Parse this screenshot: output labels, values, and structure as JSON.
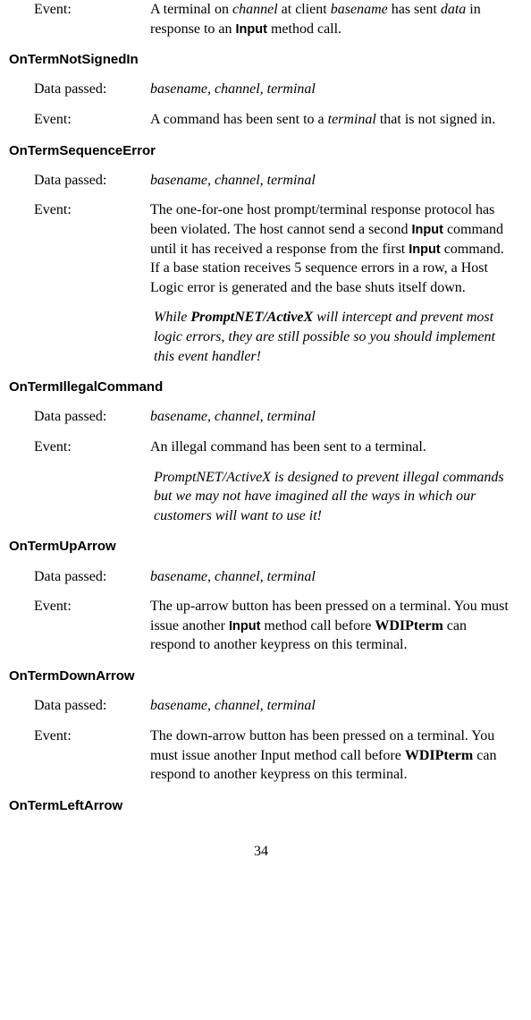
{
  "s0": {
    "event_label": "Event:",
    "event_desc": "A terminal on <em>channel</em> at client <em>basename</em> has sent <em>data</em> in response to an <span class=\"bold-sans\">Input</span> method call."
  },
  "s1": {
    "heading": "OnTermNotSignedIn",
    "data_label": "Data passed:",
    "data_desc": "<em>basename, channel, terminal</em>",
    "event_label": "Event:",
    "event_desc": "A command has been sent to a <em>terminal</em> that is not signed in."
  },
  "s2": {
    "heading": "OnTermSequenceError",
    "data_label": "Data passed:",
    "data_desc": "<em>basename, channel, terminal</em>",
    "event_label": "Event:",
    "event_desc": "The one-for-one host prompt/terminal response protocol has been violated. The host cannot send a second <span class=\"bold-sans\">Input</span> command until it has received a response from the first <span class=\"bold-sans\">Input</span> command. If a base station receives 5 sequence errors in a row, a Host Logic error is generated and the base shuts itself down.",
    "note": "<em>While <span class=\"bold-italic\">PromptNET/ActiveX</span> will intercept and prevent most logic errors, they are still possible so you should implement this event handler!</em>"
  },
  "s3": {
    "heading": "OnTermIllegalCommand",
    "data_label": "Data passed:",
    "data_desc": "<em>basename, channel, terminal</em>",
    "event_label": "Event:",
    "event_desc": "An illegal command has been sent to a terminal.",
    "note": "<em>PromptNET/ActiveX is designed to prevent illegal commands but  we may not have imagined all the ways in which our customers will want to use it!</em>"
  },
  "s4": {
    "heading": "OnTermUpArrow",
    "data_label": "Data passed:",
    "data_desc": "<em>basename, channel, terminal</em>",
    "event_label": "Event:",
    "event_desc": "The up-arrow button has been pressed on a terminal. You must issue another <span class=\"bold-sans\">Input</span> method call before <span class=\"bold-serif\">WDIPterm</span> can respond to another keypress on this terminal."
  },
  "s5": {
    "heading": "OnTermDownArrow",
    "data_label": "Data passed:",
    "data_desc": "<em>basename, channel, terminal</em>",
    "event_label": "Event:",
    "event_desc": "The down-arrow button has been pressed on a terminal. You must issue another Input method call before <span class=\"bold-serif\">WDIPterm</span> can respond to another keypress on this terminal."
  },
  "s6": {
    "heading": "OnTermLeftArrow"
  },
  "page_number": "34"
}
